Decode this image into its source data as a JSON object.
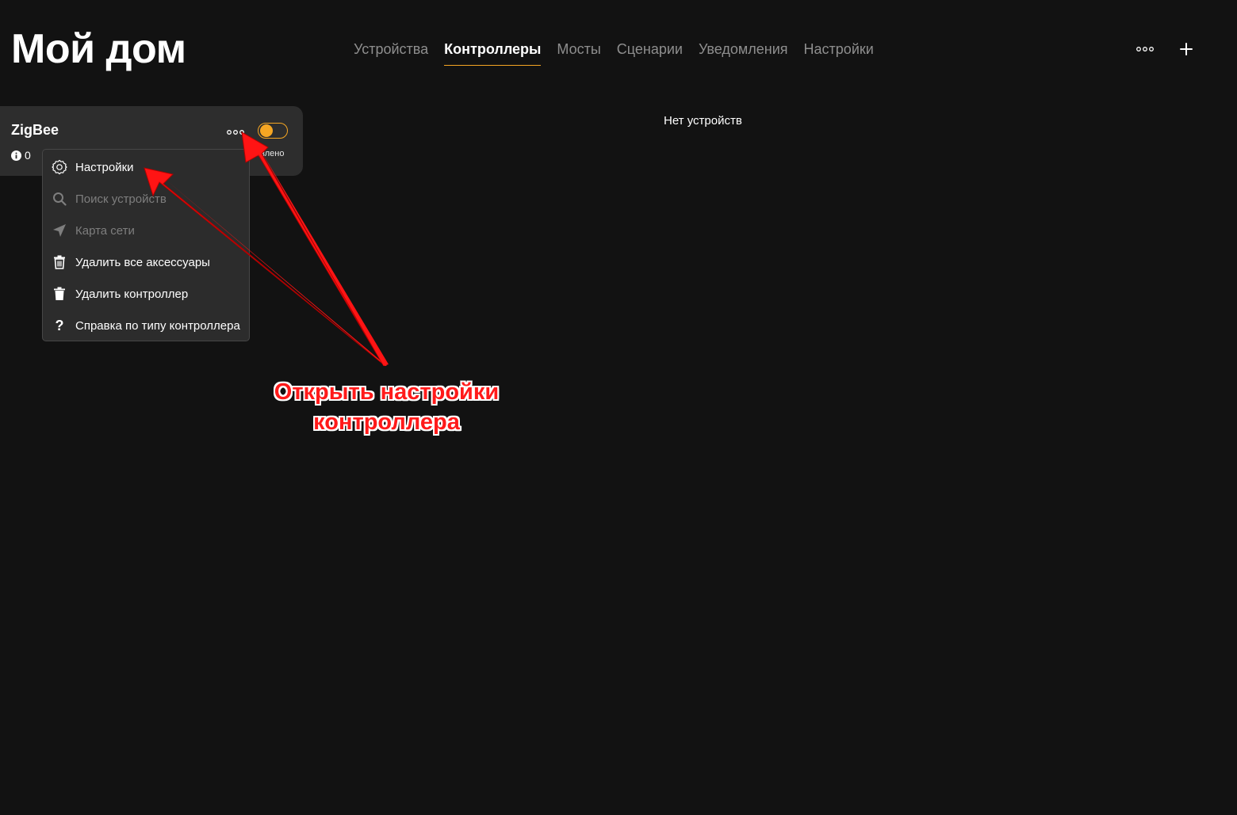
{
  "header": {
    "title": "Мой дом",
    "tabs": [
      {
        "label": "Устройства",
        "active": false
      },
      {
        "label": "Контроллеры",
        "active": true
      },
      {
        "label": "Мосты",
        "active": false
      },
      {
        "label": "Сценарии",
        "active": false
      },
      {
        "label": "Уведомления",
        "active": false
      },
      {
        "label": "Настройки",
        "active": false
      }
    ],
    "actions": [
      "more-icon",
      "plus-icon"
    ]
  },
  "controller_card": {
    "name": "ZigBee",
    "info_count": "0",
    "status": "овлено",
    "toggle_on": true
  },
  "context_menu": {
    "items": [
      {
        "label": "Настройки",
        "icon": "gear-icon",
        "disabled": false
      },
      {
        "label": "Поиск устройств",
        "icon": "search-icon",
        "disabled": true
      },
      {
        "label": "Карта сети",
        "icon": "send-icon",
        "disabled": true
      },
      {
        "label": "Удалить все аксессуары",
        "icon": "trash-icon",
        "disabled": false
      },
      {
        "label": "Удалить контроллер",
        "icon": "trash-filled-icon",
        "disabled": false
      },
      {
        "label": "Справка по типу контроллера",
        "icon": "question-icon",
        "disabled": false
      }
    ]
  },
  "main": {
    "empty_message": "Нет устройств"
  },
  "annotation": {
    "line1": "Открыть настройки",
    "line2": "контроллера",
    "color": "#ff1a1a"
  },
  "colors": {
    "background": "#121212",
    "accent": "#f5a623",
    "card": "#2d2d2d",
    "menu": "#2c2c2c"
  }
}
